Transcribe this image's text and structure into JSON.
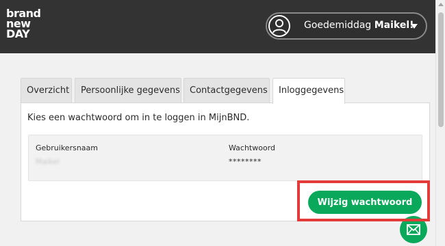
{
  "header": {
    "logo_lines": [
      "brand",
      "new",
      "DAY"
    ],
    "greeting_prefix": "Goedemiddag ",
    "user_name": "Maikel!"
  },
  "tabs": [
    {
      "label": "Overzicht",
      "active": false
    },
    {
      "label": "Persoonlijke gegevens",
      "active": false
    },
    {
      "label": "Contactgegevens",
      "active": false
    },
    {
      "label": "Inloggegevens",
      "active": true
    }
  ],
  "panel": {
    "intro": "Kies een wachtwoord om in te loggen in MijnBND.",
    "username_label": "Gebruikersnaam",
    "username_value": "Maikel",
    "password_label": "Wachtwoord",
    "password_value": "********"
  },
  "actions": {
    "change_password_label": "Wijzig wachtwoord"
  },
  "colors": {
    "header_bg": "#333333",
    "accent_green": "#0aa85a",
    "highlight_red": "#e33a3a"
  },
  "icons": {
    "avatar": "user-icon",
    "dropdown": "chevron-down-icon",
    "chat": "mail-icon"
  }
}
